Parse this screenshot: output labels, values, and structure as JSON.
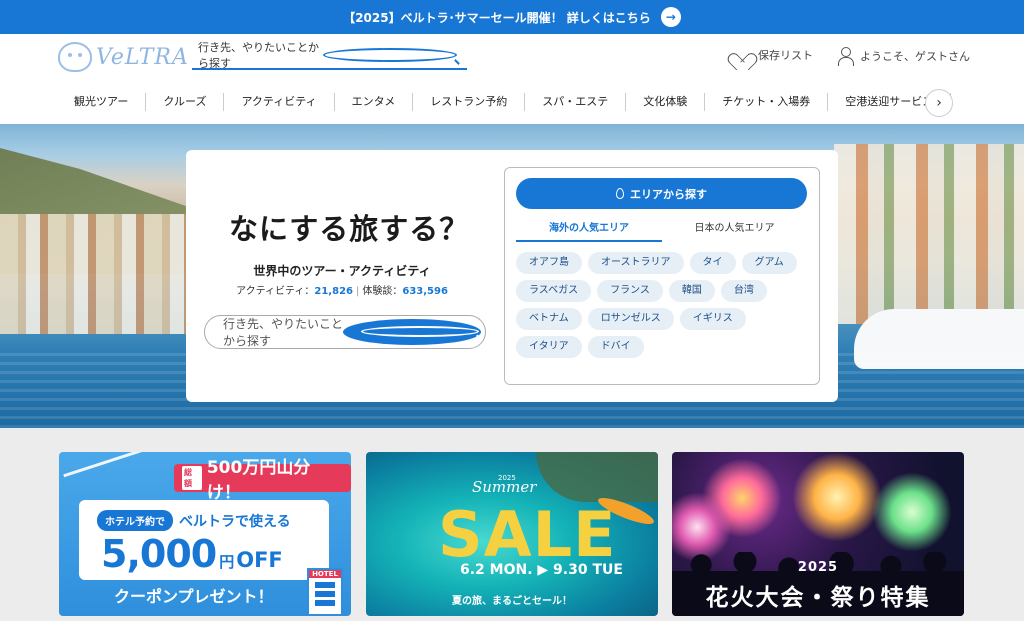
{
  "announce": {
    "text": "【2025】ベルトラ･サマーセール開催！ 詳しくはこちら",
    "arrow": "→"
  },
  "header": {
    "logo_text": "VeLTRA",
    "search_placeholder": "行き先、やりたいことから探す",
    "wishlist_label": "保存リスト",
    "user_label": "ようこそ、ゲストさん"
  },
  "nav": {
    "items": [
      "観光ツアー",
      "クルーズ",
      "アクティビティ",
      "エンタメ",
      "レストラン予約",
      "スパ・エステ",
      "文化体験",
      "チケット・入場券",
      "空港送迎サービス"
    ],
    "next": "›"
  },
  "hero": {
    "title": "なにする旅する？",
    "subtitle": "世界中のツアー・アクティビティ",
    "activities_label": "アクティビティ：",
    "activities_count": "21,826",
    "reviews_label": "体験談：",
    "reviews_count": "633,596",
    "search_placeholder": "行き先、やりたいことから探す",
    "area_button": "エリアから探す",
    "tabs": [
      "海外の人気エリア",
      "日本の人気エリア"
    ],
    "areas": [
      "オアフ島",
      "オーストラリア",
      "タイ",
      "グアム",
      "ラスベガス",
      "フランス",
      "韓国",
      "台湾",
      "ベトナム",
      "ロサンゼルス",
      "イギリス",
      "イタリア",
      "ドバイ"
    ]
  },
  "banners": {
    "coupon": {
      "badge_small": "総額",
      "badge": "500万円山分け！",
      "pill": "ホテル予約で",
      "usable": "ベルトラで使える",
      "amount": "5,000",
      "unit": "円",
      "off": "OFF",
      "bottom": "クーポンプレゼント！",
      "hotel": "HOTEL"
    },
    "summer": {
      "year": "2025",
      "summer": "Summer",
      "sale": "SALE",
      "dates": "6.2 MON. ▶ 9.30 TUE",
      "tagline": "夏の旅、まるごとセール！"
    },
    "fireworks": {
      "year": "2025",
      "title": "花火大会・祭り特集"
    }
  },
  "colors": {
    "brand_blue": "#1877d4",
    "chip_bg": "#e6eef6",
    "sale_yellow": "#f5d142",
    "coupon_red": "#e63a5a"
  }
}
